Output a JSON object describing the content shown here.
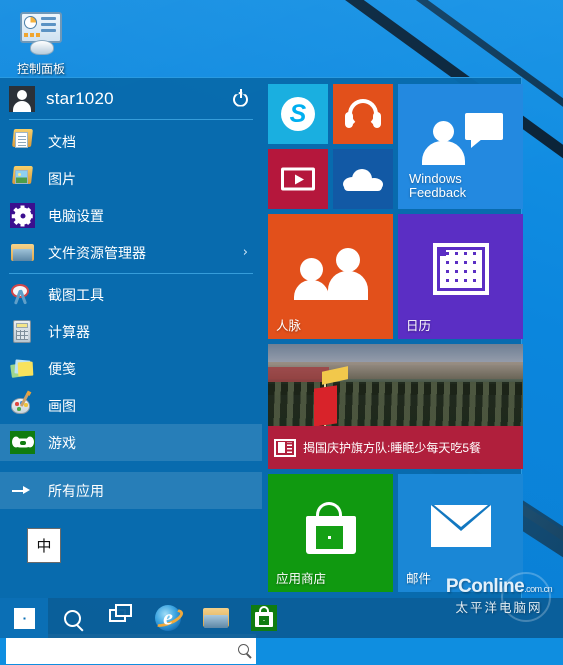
{
  "desktop": {
    "icon": {
      "label": "控制面板",
      "icon": "control-panel-icon"
    }
  },
  "start_menu": {
    "user": {
      "name": "star1020",
      "avatar_icon": "user-avatar-icon",
      "power_icon": "power-icon"
    },
    "menu_items": [
      {
        "label": "文档",
        "icon": "documents-folder-icon",
        "chevron": "",
        "highlight": false
      },
      {
        "label": "图片",
        "icon": "pictures-folder-icon",
        "chevron": "",
        "highlight": false
      },
      {
        "label": "电脑设置",
        "icon": "pc-settings-gear-icon",
        "chevron": "",
        "highlight": false
      },
      {
        "label": "文件资源管理器",
        "icon": "file-explorer-icon",
        "chevron": "›",
        "highlight": false
      },
      {
        "label": "截图工具",
        "icon": "snipping-tool-icon",
        "chevron": "",
        "highlight": false
      },
      {
        "label": "计算器",
        "icon": "calculator-icon",
        "chevron": "",
        "highlight": false
      },
      {
        "label": "便笺",
        "icon": "sticky-notes-icon",
        "chevron": "",
        "highlight": false
      },
      {
        "label": "画图",
        "icon": "paint-icon",
        "chevron": "",
        "highlight": false
      },
      {
        "label": "游戏",
        "icon": "games-xbox-icon",
        "chevron": "",
        "highlight": true
      },
      {
        "label": "所有应用",
        "icon": "all-apps-arrow-icon",
        "chevron": "",
        "highlight": true
      }
    ],
    "search": {
      "value": "",
      "placeholder": "",
      "icon": "search-icon"
    },
    "ime_indicator": {
      "text": "中"
    },
    "tiles": [
      {
        "name": "skype",
        "label": "",
        "icon": "skype-icon",
        "color": "#1aafe0"
      },
      {
        "name": "music",
        "label": "",
        "icon": "headphones-icon",
        "color": "#e2501b"
      },
      {
        "name": "video",
        "label": "",
        "icon": "video-play-icon",
        "color": "#b5173c"
      },
      {
        "name": "onedrive",
        "label": "",
        "icon": "cloud-icon",
        "color": "#1259a5"
      },
      {
        "name": "windows-feedback",
        "label": "Windows\nFeedback",
        "icon": "feedback-person-icon",
        "color": "#2389e0"
      },
      {
        "name": "people",
        "label": "人脉",
        "icon": "people-icon",
        "color": "#e2501b"
      },
      {
        "name": "calendar",
        "label": "日历",
        "icon": "calendar-grid-icon",
        "color": "#5b2ec4"
      },
      {
        "name": "news",
        "label": "揭国庆护旗方队:睡眠少每天吃5餐",
        "icon": "news-icon",
        "color": "#b01f3c"
      },
      {
        "name": "store",
        "label": "应用商店",
        "icon": "store-bag-icon",
        "color": "#109910"
      },
      {
        "name": "mail",
        "label": "邮件",
        "icon": "mail-envelope-icon",
        "color": "#1a87d6"
      }
    ]
  },
  "taskbar": {
    "items": [
      {
        "name": "start",
        "icon": "windows-logo-icon"
      },
      {
        "name": "search",
        "icon": "search-icon"
      },
      {
        "name": "task-view",
        "icon": "task-view-icon"
      },
      {
        "name": "internet-explorer",
        "icon": "internet-explorer-icon"
      },
      {
        "name": "file-explorer",
        "icon": "file-explorer-icon"
      },
      {
        "name": "store",
        "icon": "store-icon"
      }
    ]
  },
  "watermark": {
    "line1": "PConline",
    "suffix": ".com.cn",
    "line2": "太平洋电脑网"
  }
}
